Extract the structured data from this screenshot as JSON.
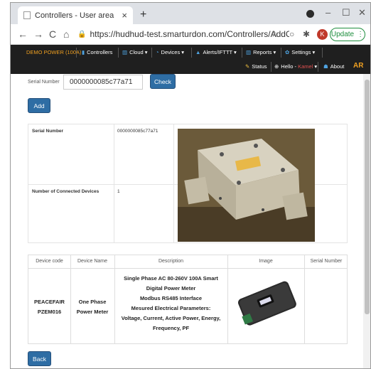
{
  "browser": {
    "tab_title": "Controllers - User area",
    "tab_close": "×",
    "new_tab": "+",
    "url": "https://hudhud-test.smarturdon.com/Controllers/AddContr...",
    "avatar_letter": "K",
    "update_label": "Update",
    "win_min": "–",
    "win_max": "☐",
    "win_close": "✕",
    "back_icon": "←",
    "forward_icon": "→",
    "reload_icon": "C",
    "home_icon": "⌂",
    "lock_icon": "🔒",
    "star_icon": "☆",
    "ext_icon": "○",
    "puzzle_icon": "✱",
    "menu_icon": "⋮"
  },
  "nav": {
    "brand": "DEMO POWER (100A)",
    "controllers": "Controllers",
    "cloud": "Cloud ▾",
    "devices": "Devices ▾",
    "alerts": "Alerts/IFTTT ▾",
    "reports": "Reports ▾",
    "settings": "Settings ▾",
    "status": "Status",
    "hello": "Hello - ",
    "hello_user": "Kamel",
    "hello_caret": " ▾",
    "about": "About",
    "ar": "AR"
  },
  "form": {
    "serial_label": "Serial Number",
    "serial_value": "0000000085c77a71",
    "check_label": "Check",
    "add_label": "Add"
  },
  "info": {
    "serial_label": "Serial Number",
    "serial_value": "0000000085c77a71",
    "connected_label": "Number of Connected Devices",
    "connected_value": "1"
  },
  "devices_table": {
    "headers": [
      "Device code",
      "Device Name",
      "Description",
      "Image",
      "Serial Number"
    ],
    "row": {
      "code_line1": "PEACEFAIR",
      "code_line2": "PZEM016",
      "name_line1": "One Phase",
      "name_line2": "Power Meter",
      "desc": [
        "Single Phase AC 80-260V 100A Smart",
        "Digital Power Meter",
        "Modbus RS485 Interface",
        "Mesured Electrical Parameters:",
        "Voltage, Current, Active Power, Energy,",
        "Frequency, PF"
      ],
      "serial": ""
    }
  },
  "back_label": "Back",
  "colors": {
    "nav_bg": "#1f1f1f",
    "brand": "#f0a020",
    "primary_btn": "#2e6da4",
    "update_green": "#1e8e3e"
  }
}
